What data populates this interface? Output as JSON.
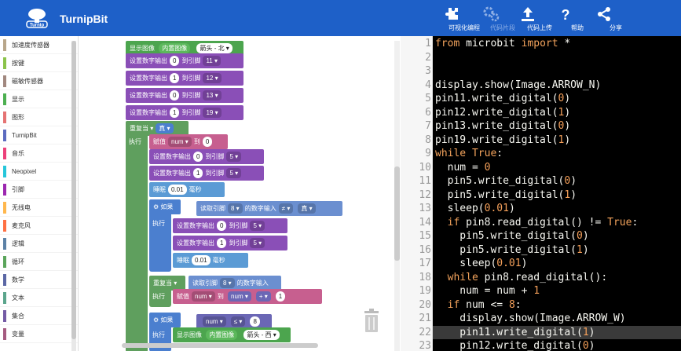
{
  "app": {
    "title": "TurnipBit",
    "logo_text": "Turnip"
  },
  "toolbar": [
    {
      "label": "可视化编程",
      "icon": "puzzle-icon"
    },
    {
      "label": "代码片段",
      "icon": "gears-icon"
    },
    {
      "label": "代码上传",
      "icon": "upload-icon"
    },
    {
      "label": "帮助",
      "icon": "help-icon"
    },
    {
      "label": "分享",
      "icon": "share-icon"
    }
  ],
  "sidebar": {
    "items": [
      {
        "label": "加速度传感器",
        "color": "#b8a68a"
      },
      {
        "label": "按键",
        "color": "#8bc34a"
      },
      {
        "label": "磁敏传感器",
        "color": "#a1887f"
      },
      {
        "label": "显示",
        "color": "#4caf50"
      },
      {
        "label": "图形",
        "color": "#e57373"
      },
      {
        "label": "TurnipBit",
        "color": "#5c6bc0"
      },
      {
        "label": "音乐",
        "color": "#ec407a"
      },
      {
        "label": "Neopixel",
        "color": "#26c6da"
      },
      {
        "label": "引脚",
        "color": "#9c27b0"
      },
      {
        "label": "无线电",
        "color": "#ffb74d"
      },
      {
        "label": "麦克风",
        "color": "#ff7043"
      },
      {
        "label": "逻辑",
        "color": "#5c81a6"
      },
      {
        "label": "循环",
        "color": "#5ba55b"
      },
      {
        "label": "数学",
        "color": "#5b67a5"
      },
      {
        "label": "文本",
        "color": "#5ba58c"
      },
      {
        "label": "集合",
        "color": "#745ba5"
      },
      {
        "label": "变量",
        "color": "#a55b80"
      }
    ]
  },
  "blocks": {
    "show_image": "显示图像",
    "builtin_image": "内置图像",
    "arrow_n": "箭头 - 北",
    "arrow_w": "箭头 - 西",
    "set_digital": "设置数字输出",
    "to_pin": "到引脚",
    "repeat_while": "重复当",
    "true_val": "真",
    "do": "执行",
    "assign": "赋值",
    "to": "到",
    "var_num": "num",
    "sleep": "睡眠",
    "ms": "毫秒",
    "sleep_val": "0.01",
    "if": "如果",
    "read_pin": "读取引脚",
    "read_digital": "的数字输入",
    "neq": "≠",
    "plus": "+",
    "lte": "≤",
    "one": "1",
    "zero": "0",
    "eight": "8",
    "pins": [
      "11",
      "12",
      "13",
      "19",
      "5",
      "8"
    ]
  },
  "editor": {
    "line_numbers": [
      "1",
      "2",
      "3",
      "4",
      "5",
      "6",
      "7",
      "8",
      "9",
      "10",
      "11",
      "12",
      "13",
      "14",
      "15",
      "16",
      "17",
      "18",
      "19",
      "20",
      "21",
      "22",
      "23"
    ],
    "active_line": 22,
    "lines": [
      "from microbit import *",
      "",
      "",
      "display.show(Image.ARROW_N)",
      "pin11.write_digital(0)",
      "pin12.write_digital(1)",
      "pin13.write_digital(0)",
      "pin19.write_digital(1)",
      "while True:",
      "  num = 0",
      "  pin5.write_digital(0)",
      "  pin5.write_digital(1)",
      "  sleep(0.01)",
      "  if pin8.read_digital() != True:",
      "    pin5.write_digital(0)",
      "    pin5.write_digital(1)",
      "    sleep(0.01)",
      "  while pin8.read_digital():",
      "    num = num + 1",
      "  if num <= 8:",
      "    display.show(Image.ARROW_W)",
      "    pin11.write_digital(1)",
      "    pin12.write_digital(0)"
    ]
  }
}
